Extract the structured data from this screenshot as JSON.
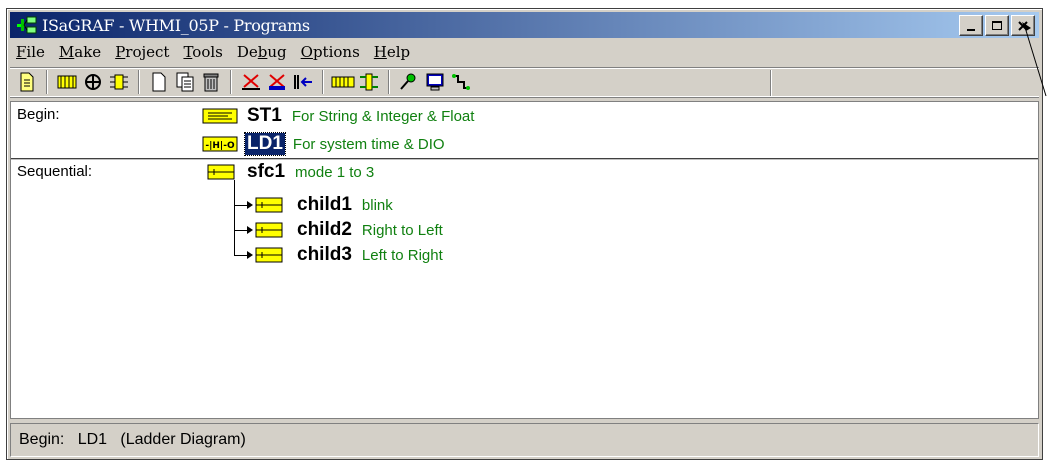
{
  "window": {
    "title": "ISaGRAF - WHMI_05P - Programs"
  },
  "menu": [
    {
      "label": "File",
      "key": "F",
      "rest": "ile"
    },
    {
      "label": "Make",
      "key": "M",
      "rest": "ake"
    },
    {
      "label": "Project",
      "key": "P",
      "rest": "roject"
    },
    {
      "label": "Tools",
      "key": "T",
      "rest": "ools"
    },
    {
      "label": "Debug",
      "pre": "De",
      "key": "b",
      "rest": "ug"
    },
    {
      "label": "Options",
      "key": "O",
      "rest": "ptions"
    },
    {
      "label": "Help",
      "key": "H",
      "rest": "elp"
    }
  ],
  "toolbar_icons": [
    "open-document-icon",
    "dictionary-icon",
    "compile-icon",
    "io-connection-icon",
    "new-program-icon",
    "copy-program-icon",
    "delete-program-icon",
    "cut-icon",
    "make-icon",
    "simulate-icon",
    "io-board-icon",
    "run-debug-icon",
    "download-icon",
    "target-icon",
    "link-icon"
  ],
  "sections": {
    "begin": {
      "label": "Begin:",
      "programs": [
        {
          "name": "ST1",
          "desc": "For String & Integer & Float",
          "lang": "ST",
          "selected": false
        },
        {
          "name": "LD1",
          "desc": "For system time & DIO",
          "lang": "LD",
          "selected": true
        }
      ]
    },
    "sequential": {
      "label": "Sequential:",
      "main": {
        "name": "sfc1",
        "desc": "mode 1 to 3"
      },
      "children": [
        {
          "name": "child1",
          "desc": "blink"
        },
        {
          "name": "child2",
          "desc": "Right to Left"
        },
        {
          "name": "child3",
          "desc": "Left to Right"
        }
      ]
    }
  },
  "status": {
    "text": "Begin:   LD1   (Ladder Diagram)"
  },
  "colors": {
    "title_start": "#0a246a",
    "title_end": "#a6caf0",
    "desc_green": "#108010",
    "icon_yellow": "#ffff00"
  }
}
